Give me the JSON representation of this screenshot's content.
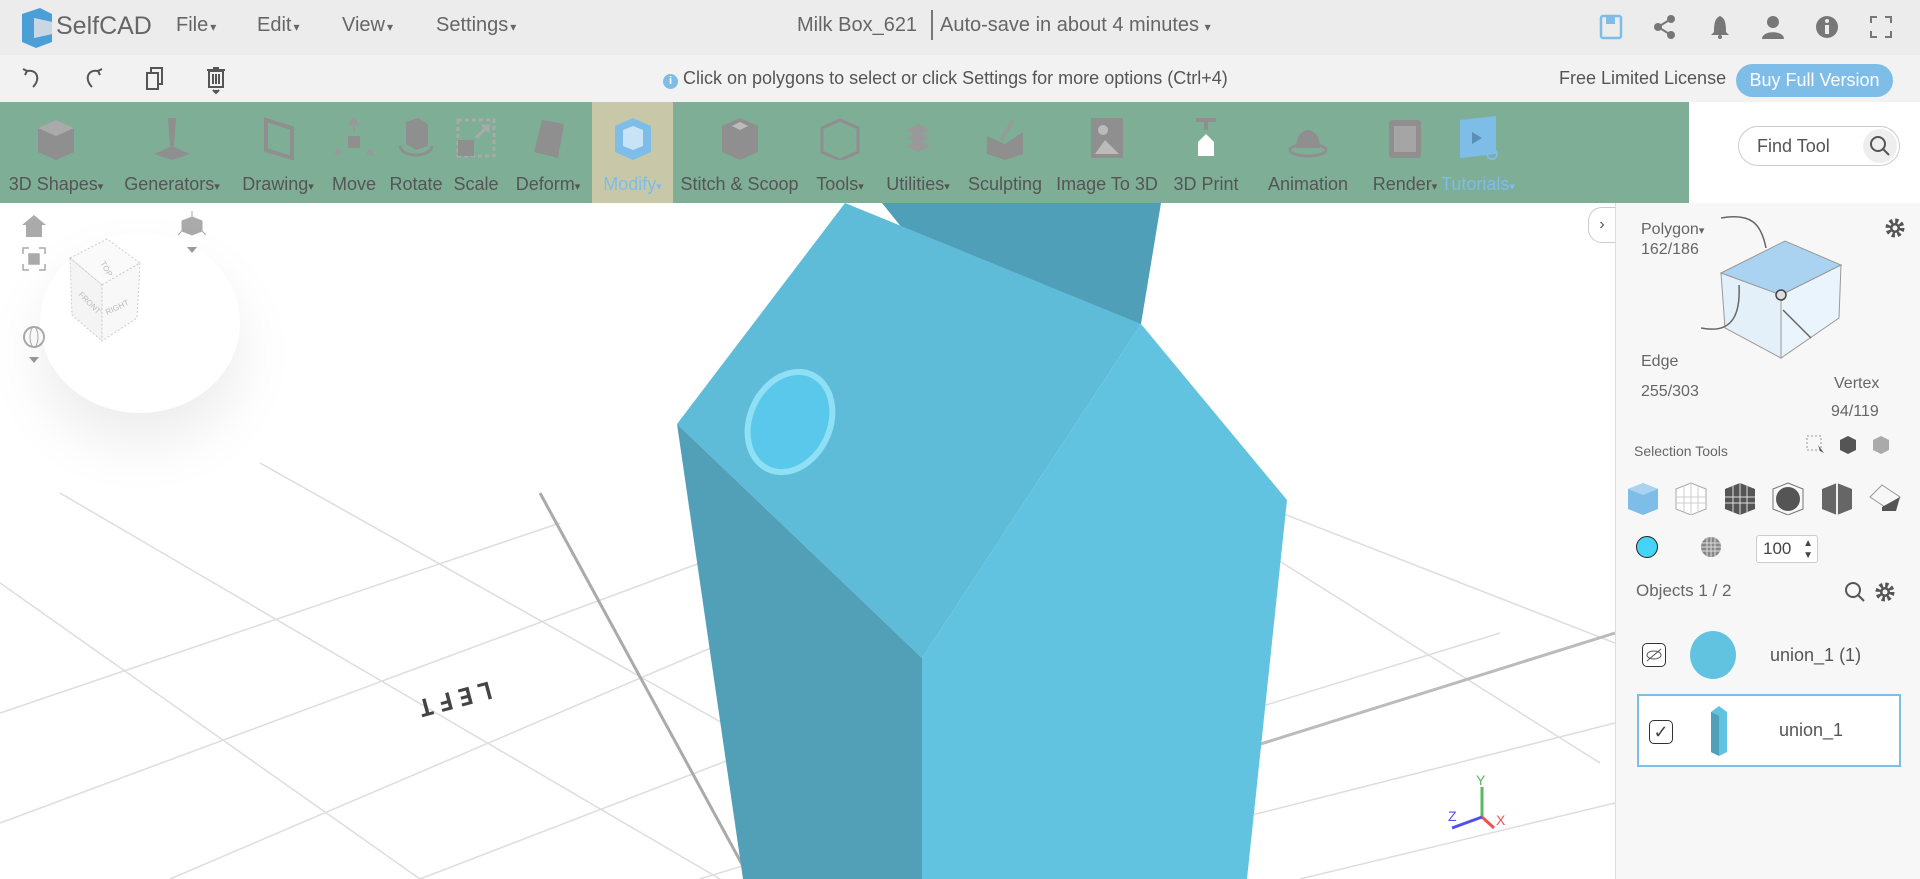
{
  "app": {
    "name": "SelfCAD"
  },
  "menu": [
    {
      "label": "File"
    },
    {
      "label": "Edit"
    },
    {
      "label": "View"
    },
    {
      "label": "Settings"
    }
  ],
  "document": {
    "title": "Milk Box_621",
    "autosave": "Auto-save in about 4 minutes"
  },
  "hint": "Click on polygons to select or click Settings for more options (Ctrl+4)",
  "license": {
    "label": "Free Limited License",
    "buy": "Buy Full Version"
  },
  "ribbon": [
    {
      "label": "3D Shapes",
      "dropdown": true
    },
    {
      "label": "Generators",
      "dropdown": true
    },
    {
      "label": "Drawing",
      "dropdown": true
    },
    {
      "label": "Move"
    },
    {
      "label": "Rotate"
    },
    {
      "label": "Scale"
    },
    {
      "label": "Deform",
      "dropdown": true
    },
    {
      "label": "Modify",
      "dropdown": true,
      "active": true
    },
    {
      "label": "Stitch & Scoop"
    },
    {
      "label": "Tools",
      "dropdown": true
    },
    {
      "label": "Utilities",
      "dropdown": true
    },
    {
      "label": "Sculpting"
    },
    {
      "label": "Image To 3D"
    },
    {
      "label": "3D Print"
    },
    {
      "label": "Animation"
    },
    {
      "label": "Render",
      "dropdown": true
    },
    {
      "label": "Tutorials",
      "dropdown": true
    }
  ],
  "find_tool": {
    "placeholder": "Find Tool"
  },
  "viewport": {
    "grid_label": "LEFT",
    "axes": {
      "x": "X",
      "y": "Y",
      "z": "Z"
    },
    "viewcube": {
      "top": "TOP",
      "front": "FRONT",
      "right": "RIGHT"
    }
  },
  "panel": {
    "polygon": {
      "label": "Polygon",
      "count": "162/186"
    },
    "edge": {
      "label": "Edge",
      "count": "255/303"
    },
    "vertex": {
      "label": "Vertex",
      "count": "94/119"
    },
    "selection_tools": "Selection Tools",
    "opacity": "100",
    "objects_label": "Objects 1 / 2",
    "objects": [
      {
        "name": "union_1 (1)",
        "visible": false
      },
      {
        "name": "union_1",
        "visible": true,
        "selected": true
      }
    ]
  },
  "colors": {
    "accent": "#7dbde8",
    "ribbon": "#7fae96",
    "model": "#62c3e0",
    "model_dark": "#52a0b8",
    "active_tab": "#c8c8a8",
    "swatch": "#45d3f7"
  }
}
